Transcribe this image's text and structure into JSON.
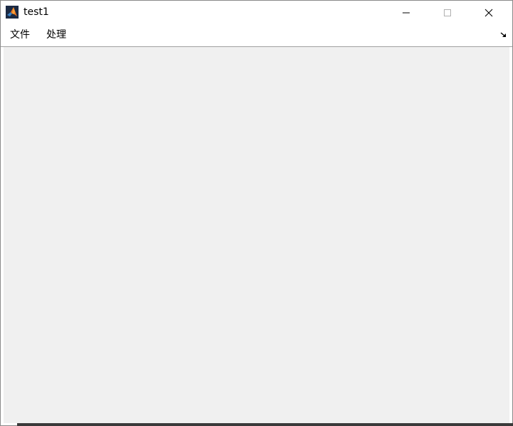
{
  "window": {
    "title": "test1"
  },
  "menubar": {
    "items": [
      {
        "label": "文件"
      },
      {
        "label": "处理"
      }
    ]
  },
  "icons": {
    "app": "matlab-logo-icon",
    "minimize": "minimize-icon",
    "maximize": "maximize-icon",
    "close": "close-icon",
    "dock": "dock-arrow-icon"
  },
  "colors": {
    "canvas": "#f0f0f0",
    "titlebar": "#ffffff"
  }
}
